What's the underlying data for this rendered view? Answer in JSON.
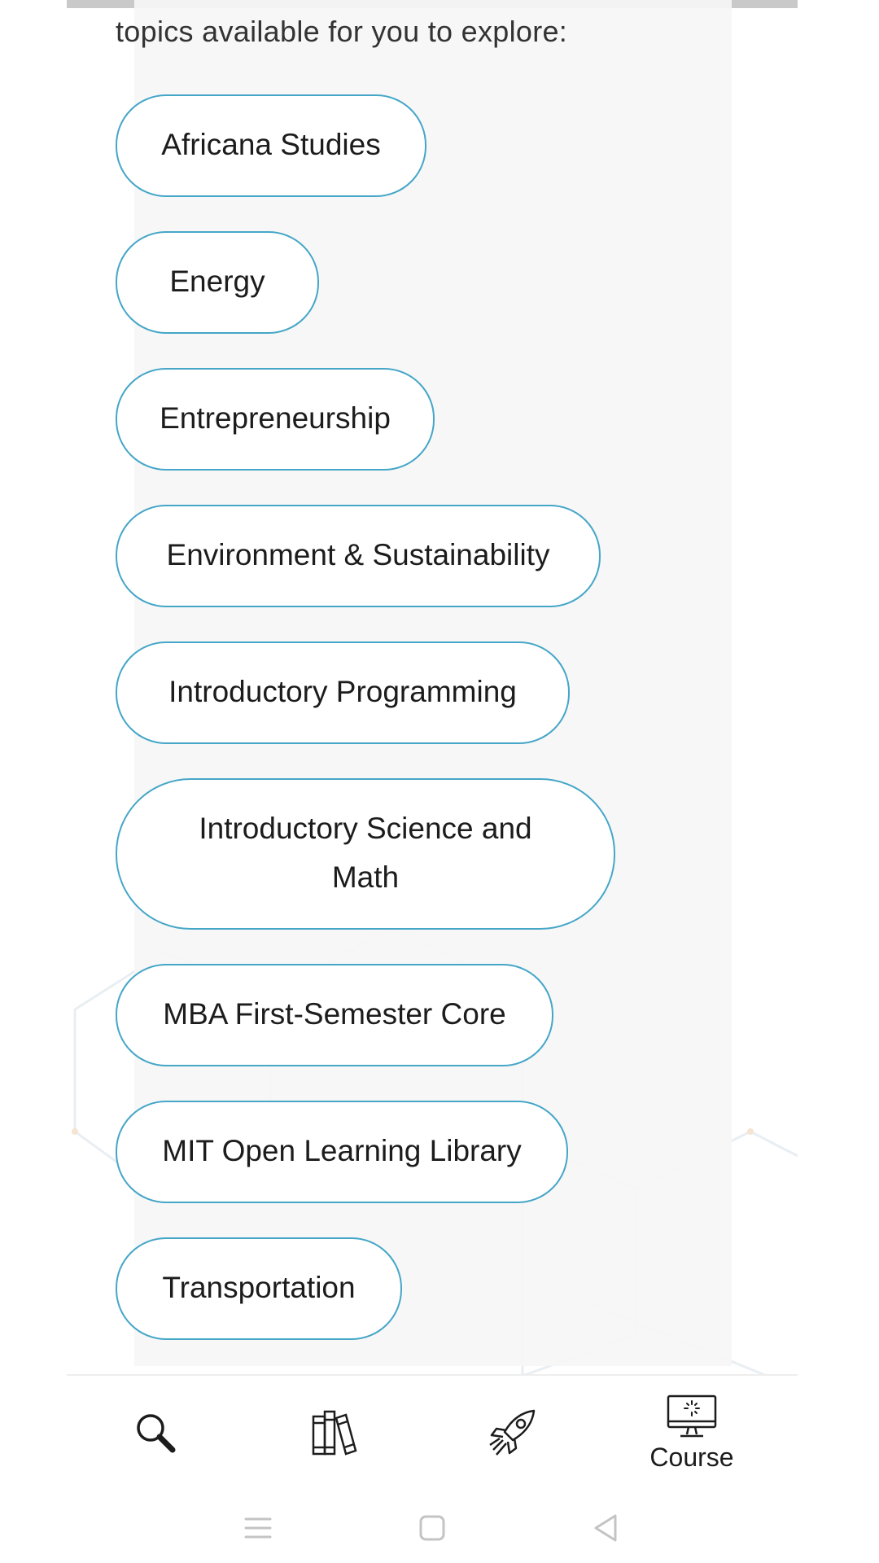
{
  "intro_text": "topics available for you to explore:",
  "topics": [
    {
      "label": "Africana Studies"
    },
    {
      "label": "Energy"
    },
    {
      "label": "Entrepreneurship"
    },
    {
      "label": "Environment & Sustainability"
    },
    {
      "label": "Introductory Programming"
    },
    {
      "label": "Introductory Science and Math"
    },
    {
      "label": "MBA First-Semester Core"
    },
    {
      "label": "MIT Open Learning Library"
    },
    {
      "label": "Transportation"
    }
  ],
  "bottom_nav": {
    "items": [
      {
        "icon": "search-icon",
        "label": ""
      },
      {
        "icon": "books-icon",
        "label": ""
      },
      {
        "icon": "rocket-icon",
        "label": ""
      },
      {
        "icon": "monitor-icon",
        "label": "Course"
      }
    ]
  },
  "system_nav": {
    "icons": [
      "menu-icon",
      "home-icon",
      "back-icon"
    ]
  },
  "colors": {
    "accent": "#45a6c8",
    "panel": "#f6f6f6",
    "text": "#1c1c1c"
  }
}
